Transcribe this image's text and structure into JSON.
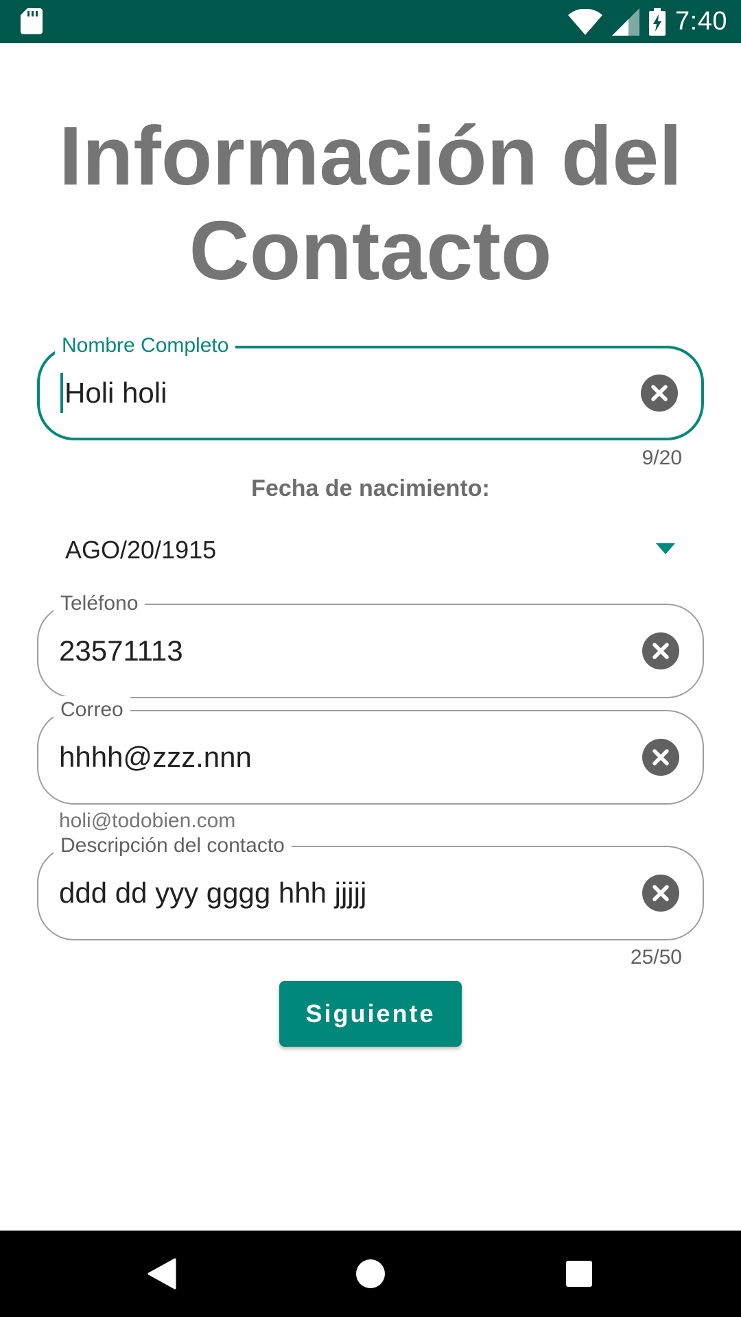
{
  "status_bar": {
    "time": "7:40",
    "icons": [
      "sd-card-icon",
      "wifi-icon",
      "cell-signal-icon",
      "battery-charging-icon"
    ]
  },
  "page": {
    "title": "Información del Contacto"
  },
  "form": {
    "full_name": {
      "label": "Nombre Completo",
      "value": "Holi holi",
      "counter": "9/20",
      "focused": true
    },
    "birth_date": {
      "label": "Fecha de nacimiento:",
      "value": "AGO/20/1915"
    },
    "phone": {
      "label": "Teléfono",
      "value": "23571113"
    },
    "email": {
      "label": "Correo",
      "value": "hhhh@zzz.nnn",
      "helper": "holi@todobien.com"
    },
    "description": {
      "label": "Descripción del contacto",
      "value": "ddd dd yyy gggg hhh jjjjj",
      "counter": "25/50"
    },
    "next_button": "Siguiente"
  },
  "colors": {
    "status_bar": "#00574b",
    "accent": "#00897b",
    "title": "#757575"
  },
  "nav_bar": {
    "icons": [
      "back-icon",
      "home-icon",
      "recents-icon"
    ]
  }
}
